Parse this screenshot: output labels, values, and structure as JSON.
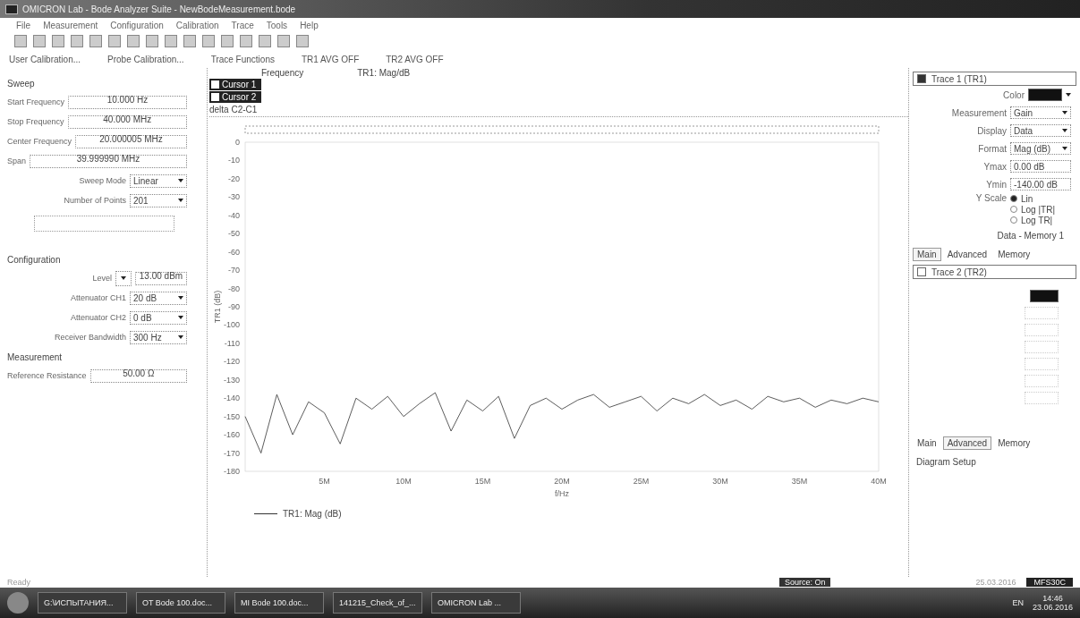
{
  "window": {
    "title": "OMICRON Lab - Bode Analyzer Suite - NewBodeMeasurement.bode"
  },
  "menu": [
    "File",
    "Measurement",
    "Configuration",
    "Calibration",
    "Trace",
    "Tools",
    "Help"
  ],
  "toolbar2": {
    "user_calibration": "User Calibration...",
    "probe_calibration": "Probe Calibration...",
    "trace_functions": "Trace Functions",
    "tr1_avg": "TR1 AVG OFF",
    "tr2_avg": "TR2 AVG OFF"
  },
  "sweep": {
    "title": "Sweep",
    "fields": [
      {
        "label": "Start Frequency",
        "value": "10.000 Hz",
        "kind": "text"
      },
      {
        "label": "Stop Frequency",
        "value": "40.000 MHz",
        "kind": "text"
      },
      {
        "label": "Center Frequency",
        "value": "20.000005 MHz",
        "kind": "text"
      },
      {
        "label": "Span",
        "value": "39.999990 MHz",
        "kind": "text"
      },
      {
        "label": "Sweep Mode",
        "value": "Linear",
        "kind": "select"
      },
      {
        "label": "Number of Points",
        "value": "201",
        "kind": "select"
      }
    ]
  },
  "configuration": {
    "title": "Configuration",
    "fields": [
      {
        "label": "Level",
        "value": "13.00 dBm",
        "kind": "level"
      },
      {
        "label": "Attenuator CH1",
        "value": "20 dB",
        "kind": "select"
      },
      {
        "label": "Attenuator CH2",
        "value": "0 dB",
        "kind": "select"
      },
      {
        "label": "Receiver Bandwidth",
        "value": "300 Hz",
        "kind": "select"
      }
    ]
  },
  "measurement": {
    "title": "Measurement",
    "fields": [
      {
        "label": "Reference Resistance",
        "value": "50.00 Ω",
        "kind": "text"
      }
    ]
  },
  "cursor_table": {
    "columns": [
      "Frequency",
      "TR1: Mag/dB"
    ],
    "cursors": [
      {
        "label": "Cursor 1",
        "checked": false
      },
      {
        "label": "Cursor 2",
        "checked": false
      }
    ],
    "delta": "delta C2-C1"
  },
  "chart": {
    "chart_data": {
      "type": "line",
      "xlabel": "f/Hz",
      "ylabel": "TR1 (dB)",
      "xlim": [
        0,
        40
      ],
      "ylim": [
        -180,
        0
      ],
      "xticks": [
        {
          "value": 5,
          "label": "5M"
        },
        {
          "value": 10,
          "label": "10M"
        },
        {
          "value": 15,
          "label": "15M"
        },
        {
          "value": 20,
          "label": "20M"
        },
        {
          "value": 25,
          "label": "25M"
        },
        {
          "value": 30,
          "label": "30M"
        },
        {
          "value": 35,
          "label": "35M"
        },
        {
          "value": 40,
          "label": "40M"
        }
      ],
      "yticks": [
        0,
        -10,
        -20,
        -30,
        -40,
        -50,
        -60,
        -70,
        -80,
        -90,
        -100,
        -110,
        -120,
        -130,
        -140,
        -150,
        -160,
        -170,
        -180
      ],
      "x": [
        0,
        1,
        2,
        3,
        4,
        5,
        6,
        7,
        8,
        9,
        10,
        11,
        12,
        13,
        14,
        15,
        16,
        17,
        18,
        19,
        20,
        21,
        22,
        23,
        24,
        25,
        26,
        27,
        28,
        29,
        30,
        31,
        32,
        33,
        34,
        35,
        36,
        37,
        38,
        39,
        40
      ],
      "series": [
        {
          "name": "TR1: Mag (dB)",
          "color": "#333333",
          "values": [
            -150,
            -170,
            -138,
            -160,
            -142,
            -148,
            -165,
            -140,
            -146,
            -139,
            -150,
            -143,
            -137,
            -158,
            -141,
            -147,
            -139,
            -162,
            -144,
            -140,
            -146,
            -141,
            -138,
            -145,
            -142,
            -139,
            -147,
            -140,
            -143,
            -138,
            -144,
            -141,
            -146,
            -139,
            -142,
            -140,
            -145,
            -141,
            -143,
            -140,
            -142
          ]
        }
      ]
    }
  },
  "trace1": {
    "title": "Trace 1 (TR1)",
    "checked": true,
    "fields": [
      {
        "label": "Color",
        "kind": "color",
        "color": "#111111"
      },
      {
        "label": "Measurement",
        "value": "Gain",
        "kind": "select"
      },
      {
        "label": "Display",
        "value": "Data",
        "kind": "select"
      },
      {
        "label": "Format",
        "value": "Mag (dB)",
        "kind": "select"
      },
      {
        "label": "Ymax",
        "value": "0.00 dB",
        "kind": "text"
      },
      {
        "label": "Ymin",
        "value": "-140.00 dB",
        "kind": "text"
      }
    ],
    "y_scale": {
      "label": "Y Scale",
      "options": [
        {
          "label": "Lin",
          "selected": true
        },
        {
          "label": "Log |TR|",
          "selected": false
        },
        {
          "label": "Log TR|",
          "selected": false
        }
      ]
    },
    "data_memory": "Data - Memory 1",
    "tabs": [
      {
        "label": "Main",
        "selected": true
      },
      {
        "label": "Advanced",
        "selected": false
      },
      {
        "label": "Memory",
        "selected": false
      }
    ]
  },
  "trace2": {
    "title": "Trace 2 (TR2)",
    "checked": false,
    "tabs": [
      {
        "label": "Main",
        "selected": false
      },
      {
        "label": "Advanced",
        "selected": true
      },
      {
        "label": "Memory",
        "selected": false
      }
    ]
  },
  "diagram_setup": "Diagram Setup",
  "status_bar": {
    "left": "Ready",
    "source": "Source: On",
    "date": "25.03.2016",
    "device": "MFS30C"
  },
  "taskbar": {
    "items": [
      "G:\\ИСПЫТАНИЯ...",
      "OT Bode 100.doc...",
      "MI Bode 100.doc...",
      "141215_Check_of_...",
      "OMICRON Lab ..."
    ],
    "lang": "EN",
    "time": "14:46",
    "date": "23.06.2016"
  }
}
